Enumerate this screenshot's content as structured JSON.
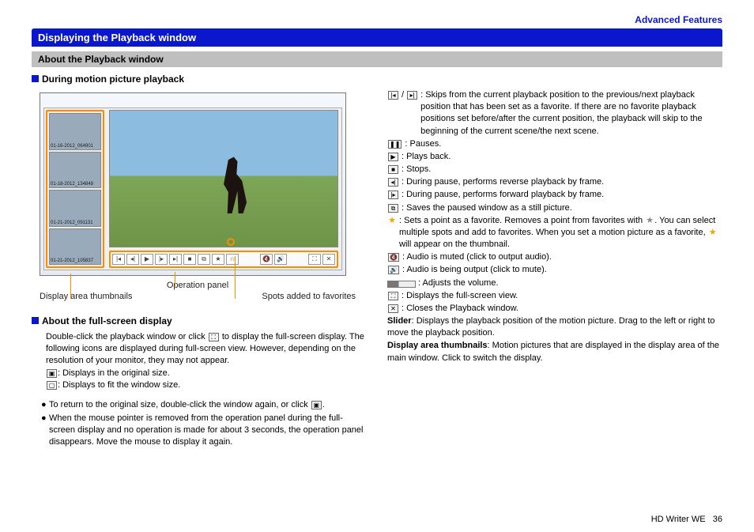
{
  "header": {
    "section_link": "Advanced Features"
  },
  "h1": "Displaying the Playback window",
  "h2": "About the Playback window",
  "h3_motion": "During motion picture playback",
  "h3_fullscreen": "About the full-screen display",
  "screenshot": {
    "thumb_labels": [
      "01-16-2012_064901",
      "01-18-2012_134848",
      "01-21-2012_091131",
      "01-21-2012_105837"
    ]
  },
  "captions": {
    "operation_panel": "Operation panel",
    "display_thumbs": "Display area thumbnails",
    "favorites": "Spots added to favorites"
  },
  "fullscreen": {
    "intro_a": "Double-click the playback window or click ",
    "intro_b": " to display the full-screen display. The following icons are displayed during full-screen view. However, depending on the resolution of your monitor, they may not appear.",
    "orig_size": ": Displays in the original size.",
    "fit_size": ": Displays to fit the window size.",
    "note1_a": "To return to the original size, double-click the window again, or click ",
    "note1_b": ".",
    "note2": "When the mouse pointer is removed from the operation panel during the full-screen display and no operation is made for about 3 seconds, the operation panel disappears. Move the mouse to display it again."
  },
  "controls": {
    "skip": ": Skips from the current playback position to the previous/next playback position that has been set as a favorite. If there are no favorite playback positions set before/after the current position, the playback will skip to the beginning of the current scene/the next scene.",
    "pause": ": Pauses.",
    "play": ": Plays back.",
    "stop": ": Stops.",
    "rev_frame": ": During pause, performs reverse playback by frame.",
    "fwd_frame": ": During pause, performs forward playback by frame.",
    "save_still": ": Saves the paused window as a still picture.",
    "fav_a": ": Sets a point as a favorite. Removes a point from favorites with ",
    "fav_b": ". You can select multiple spots and add to favorites. When you set a motion picture as a favorite, ",
    "fav_c": " will appear on the thumbnail.",
    "muted": ": Audio is muted (click to output audio).",
    "unmuted": ": Audio is being output (click to mute).",
    "volume": ": Adjusts the volume.",
    "fullscreen": ": Displays the full-screen view.",
    "close": ": Closes the Playback window.",
    "slider_label": "Slider",
    "slider_text": ": Displays the playback position of the motion picture. Drag to the left or right to move the playback position.",
    "thumbs_label": "Display area thumbnails",
    "thumbs_text": ": Motion pictures that are displayed in the display area of the main window. Click to switch the display."
  },
  "footer": {
    "product": "HD Writer WE",
    "page": "36"
  }
}
